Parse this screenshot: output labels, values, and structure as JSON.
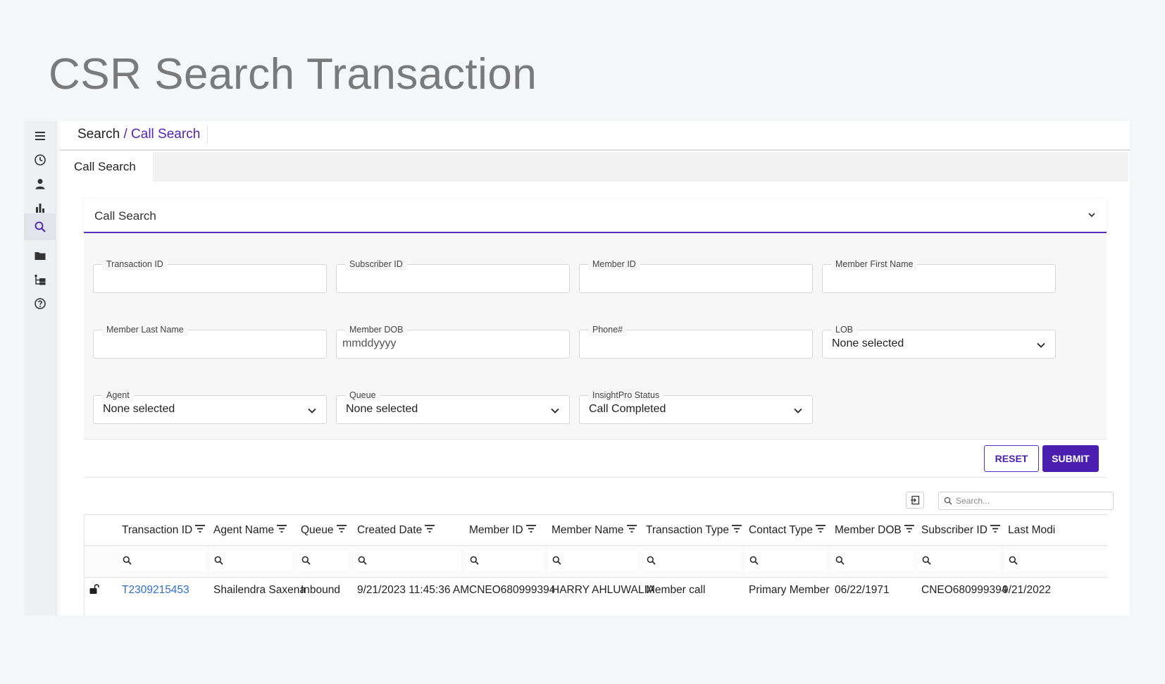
{
  "page": {
    "title": "CSR Search Transaction"
  },
  "sidebar": {
    "items": [
      {
        "icon": "menu-icon"
      },
      {
        "icon": "clock-icon"
      },
      {
        "icon": "user-icon"
      },
      {
        "icon": "bar-chart-icon"
      },
      {
        "icon": "search-icon",
        "active": true
      },
      {
        "icon": "folder-icon"
      },
      {
        "icon": "hierarchy-icon"
      },
      {
        "icon": "help-icon"
      }
    ]
  },
  "breadcrumb": {
    "root": "Search",
    "separator": "/",
    "current": "Call Search"
  },
  "tabs": [
    {
      "label": "Call Search"
    }
  ],
  "panel": {
    "title": "Call Search",
    "fields": {
      "transaction_id": {
        "label": "Transaction ID",
        "value": ""
      },
      "subscriber_id": {
        "label": "Subscriber ID",
        "value": ""
      },
      "member_id": {
        "label": "Member ID",
        "value": ""
      },
      "member_first_name": {
        "label": "Member First Name",
        "value": ""
      },
      "member_last_name": {
        "label": "Member Last Name",
        "value": ""
      },
      "member_dob": {
        "label": "Member DOB",
        "placeholder": "mmddyyyy"
      },
      "phone": {
        "label": "Phone#",
        "value": ""
      },
      "lob": {
        "label": "LOB",
        "value": "None selected"
      },
      "agent": {
        "label": "Agent",
        "value": "None selected"
      },
      "queue": {
        "label": "Queue",
        "value": "None selected"
      },
      "insightpro_status": {
        "label": "InsightPro Status",
        "value": "Call Completed"
      }
    },
    "reset_label": "RESET",
    "submit_label": "SUBMIT"
  },
  "grid": {
    "search_placeholder": "Search...",
    "columns": [
      "Transaction ID",
      "Agent Name",
      "Queue",
      "Created Date",
      "Member ID",
      "Member Name",
      "Transaction Type",
      "Contact Type",
      "Member DOB",
      "Subscriber ID",
      "Last Modi"
    ],
    "rows": [
      {
        "transaction_id": "T2309215453",
        "agent_name": "Shailendra Saxena",
        "queue": "Inbound",
        "created_date": "9/21/2023 11:45:36 AM",
        "member_id": "CNEO680999394",
        "member_name": "HARRY AHLUWALIA",
        "transaction_type": "Member call",
        "contact_type": "Primary Member",
        "member_dob": "06/22/1971",
        "subscriber_id": "CNEO680999394",
        "last_modified": "9/21/2022"
      }
    ]
  },
  "colors": {
    "accent": "#4a1fb0",
    "link": "#2f6fcf",
    "title_gray": "#7a7a7a"
  }
}
